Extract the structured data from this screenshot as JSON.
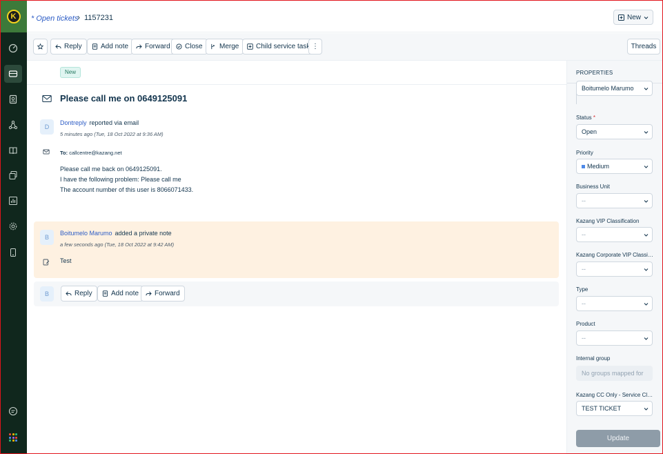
{
  "header": {
    "breadcrumb_link": "* Open tickets",
    "breadcrumb_sep": "›",
    "ticket_id": "1157231",
    "new_label": "New"
  },
  "toolbar": {
    "reply": "Reply",
    "add_note": "Add note",
    "forward": "Forward",
    "close": "Close",
    "merge": "Merge",
    "child_task": "Child service task",
    "more": "⋮",
    "threads": "Threads"
  },
  "ticket": {
    "status_badge": "New",
    "subject": "Please call me on 0649125091"
  },
  "message": {
    "avatar": "D",
    "sender": "Dontreply",
    "sender_action": "reported via email",
    "time": "5 minutes ago (Tue, 18 Oct 2022 at 9:36 AM)",
    "to_label": "To:",
    "to_value": "callcentre@kazang.net",
    "body": [
      "Please call me back on 0649125091.",
      "I have the following problem: Please call me",
      "The account number of this user is 8066071433."
    ]
  },
  "note": {
    "avatar": "B",
    "sender": "Boitumelo Marumo",
    "sender_action": "added a private note",
    "time": "a few seconds ago (Tue, 18 Oct 2022 at 9:42 AM)",
    "body": "Test"
  },
  "reply_bar": {
    "avatar": "B",
    "reply": "Reply",
    "add_note": "Add note",
    "forward": "Forward"
  },
  "properties": {
    "title": "PROPERTIES",
    "agent": "Boitumelo Marumo",
    "fields": {
      "status": {
        "label": "Status",
        "required": "*",
        "value": "Open"
      },
      "priority": {
        "label": "Priority",
        "value": "Medium",
        "color": "#4d89e8"
      },
      "business_unit": {
        "label": "Business Unit",
        "value": "--"
      },
      "vip": {
        "label": "Kazang VIP Classification",
        "value": "--"
      },
      "corp_vip": {
        "label": "Kazang Corporate VIP Classifica...",
        "value": "--"
      },
      "type": {
        "label": "Type",
        "value": "--"
      },
      "product": {
        "label": "Product",
        "value": "--"
      },
      "internal_group": {
        "label": "Internal group",
        "value": "No groups mapped for ..."
      },
      "cc_service": {
        "label": "Kazang CC Only - Service Classif...",
        "value": "TEST TICKET"
      }
    },
    "update": "Update"
  },
  "colors": {
    "sidebar": "#10271d",
    "logo_bg": "#3d7a3a",
    "link": "#2c5cc5",
    "note_bg": "#fef1e1",
    "frame": "#e1141b"
  }
}
